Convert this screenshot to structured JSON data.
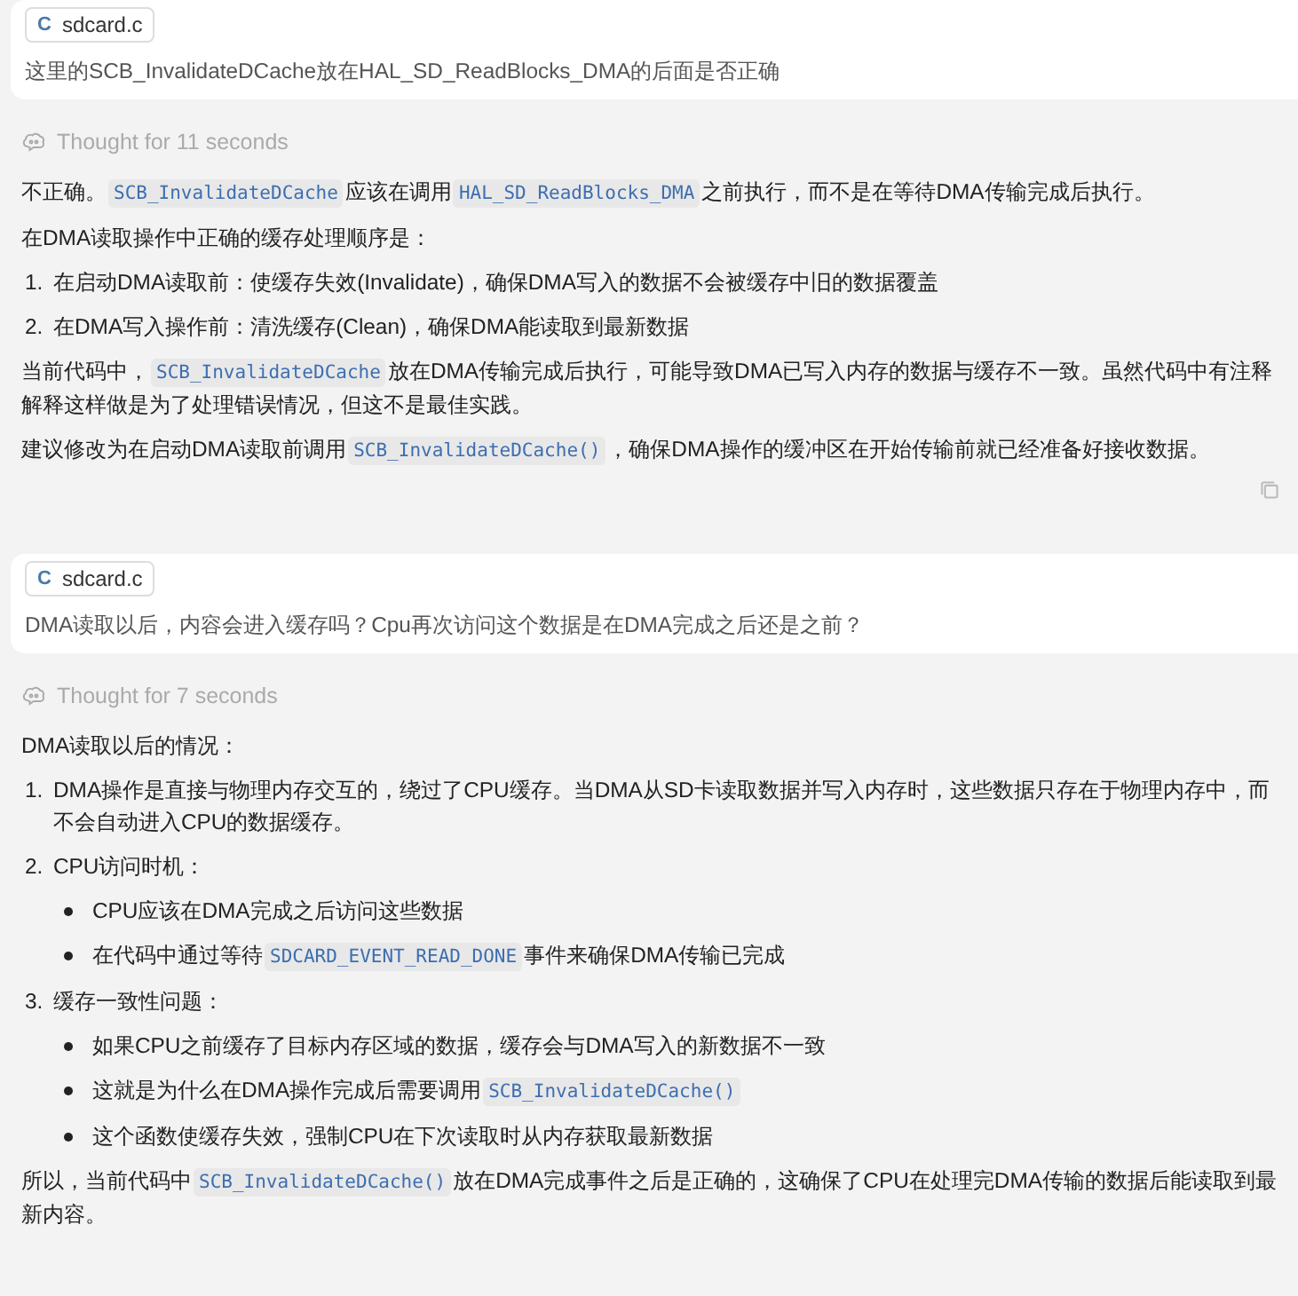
{
  "messages": [
    {
      "kind": "user",
      "attachment": {
        "icon_letter": "C",
        "name": "sdcard.c"
      },
      "text": "这里的SCB_InvalidateDCache放在HAL_SD_ReadBlocks_DMA的后面是否正确"
    },
    {
      "kind": "assistant",
      "thought": "Thought for 11 seconds",
      "copy_button": true,
      "blocks": [
        {
          "kind": "paragraph",
          "segments": [
            {
              "kind": "text",
              "text": "不正确。"
            },
            {
              "kind": "code",
              "text": "SCB_InvalidateDCache"
            },
            {
              "kind": "text",
              "text": "应该在调用"
            },
            {
              "kind": "code",
              "text": "HAL_SD_ReadBlocks_DMA"
            },
            {
              "kind": "text",
              "text": "之前执行，而不是在等待DMA传输完成后执行。"
            }
          ]
        },
        {
          "kind": "paragraph",
          "segments": [
            {
              "kind": "text",
              "text": "在DMA读取操作中正确的缓存处理顺序是："
            }
          ]
        },
        {
          "kind": "ordered_list",
          "items": [
            {
              "number": "1.",
              "segments": [
                {
                  "kind": "text",
                  "text": "在启动DMA读取前：使缓存失效(Invalidate)，确保DMA写入的数据不会被缓存中旧的数据覆盖"
                }
              ]
            },
            {
              "number": "2.",
              "segments": [
                {
                  "kind": "text",
                  "text": "在DMA写入操作前：清洗缓存(Clean)，确保DMA能读取到最新数据"
                }
              ]
            }
          ]
        },
        {
          "kind": "paragraph",
          "segments": [
            {
              "kind": "text",
              "text": "当前代码中，"
            },
            {
              "kind": "code",
              "text": "SCB_InvalidateDCache"
            },
            {
              "kind": "text",
              "text": "放在DMA传输完成后执行，可能导致DMA已写入内存的数据与缓存不一致。虽然代码中有注释解释这样做是为了处理错误情况，但这不是最佳实践。"
            }
          ]
        },
        {
          "kind": "paragraph",
          "segments": [
            {
              "kind": "text",
              "text": "建议修改为在启动DMA读取前调用"
            },
            {
              "kind": "code",
              "text": "SCB_InvalidateDCache()"
            },
            {
              "kind": "text",
              "text": "，确保DMA操作的缓冲区在开始传输前就已经准备好接收数据。"
            }
          ]
        }
      ]
    },
    {
      "kind": "user",
      "attachment": {
        "icon_letter": "C",
        "name": "sdcard.c"
      },
      "text": "DMA读取以后，内容会进入缓存吗？Cpu再次访问这个数据是在DMA完成之后还是之前？"
    },
    {
      "kind": "assistant",
      "thought": "Thought for 7 seconds",
      "copy_button": false,
      "blocks": [
        {
          "kind": "paragraph",
          "segments": [
            {
              "kind": "text",
              "text": "DMA读取以后的情况："
            }
          ]
        },
        {
          "kind": "ordered_list",
          "items": [
            {
              "number": "1.",
              "segments": [
                {
                  "kind": "text",
                  "text": "DMA操作是直接与物理内存交互的，绕过了CPU缓存。当DMA从SD卡读取数据并写入内存时，这些数据只存在于物理内存中，而不会自动进入CPU的数据缓存。"
                }
              ]
            },
            {
              "number": "2.",
              "segments": [
                {
                  "kind": "text",
                  "text": "CPU访问时机："
                }
              ],
              "children": [
                {
                  "segments": [
                    {
                      "kind": "text",
                      "text": "CPU应该在DMA完成之后访问这些数据"
                    }
                  ]
                },
                {
                  "segments": [
                    {
                      "kind": "text",
                      "text": "在代码中通过等待"
                    },
                    {
                      "kind": "code",
                      "text": "SDCARD_EVENT_READ_DONE"
                    },
                    {
                      "kind": "text",
                      "text": "事件来确保DMA传输已完成"
                    }
                  ]
                }
              ]
            },
            {
              "number": "3.",
              "segments": [
                {
                  "kind": "text",
                  "text": "缓存一致性问题："
                }
              ],
              "children": [
                {
                  "segments": [
                    {
                      "kind": "text",
                      "text": "如果CPU之前缓存了目标内存区域的数据，缓存会与DMA写入的新数据不一致"
                    }
                  ]
                },
                {
                  "segments": [
                    {
                      "kind": "text",
                      "text": "这就是为什么在DMA操作完成后需要调用"
                    },
                    {
                      "kind": "code",
                      "text": "SCB_InvalidateDCache()"
                    }
                  ]
                },
                {
                  "segments": [
                    {
                      "kind": "text",
                      "text": "这个函数使缓存失效，强制CPU在下次读取时从内存获取最新数据"
                    }
                  ]
                }
              ]
            }
          ]
        },
        {
          "kind": "paragraph",
          "segments": [
            {
              "kind": "text",
              "text": "所以，当前代码中"
            },
            {
              "kind": "code",
              "text": "SCB_InvalidateDCache()"
            },
            {
              "kind": "text",
              "text": "放在DMA完成事件之后是正确的，这确保了CPU在处理完DMA传输的数据后能读取到最新内容。"
            }
          ]
        }
      ]
    }
  ]
}
